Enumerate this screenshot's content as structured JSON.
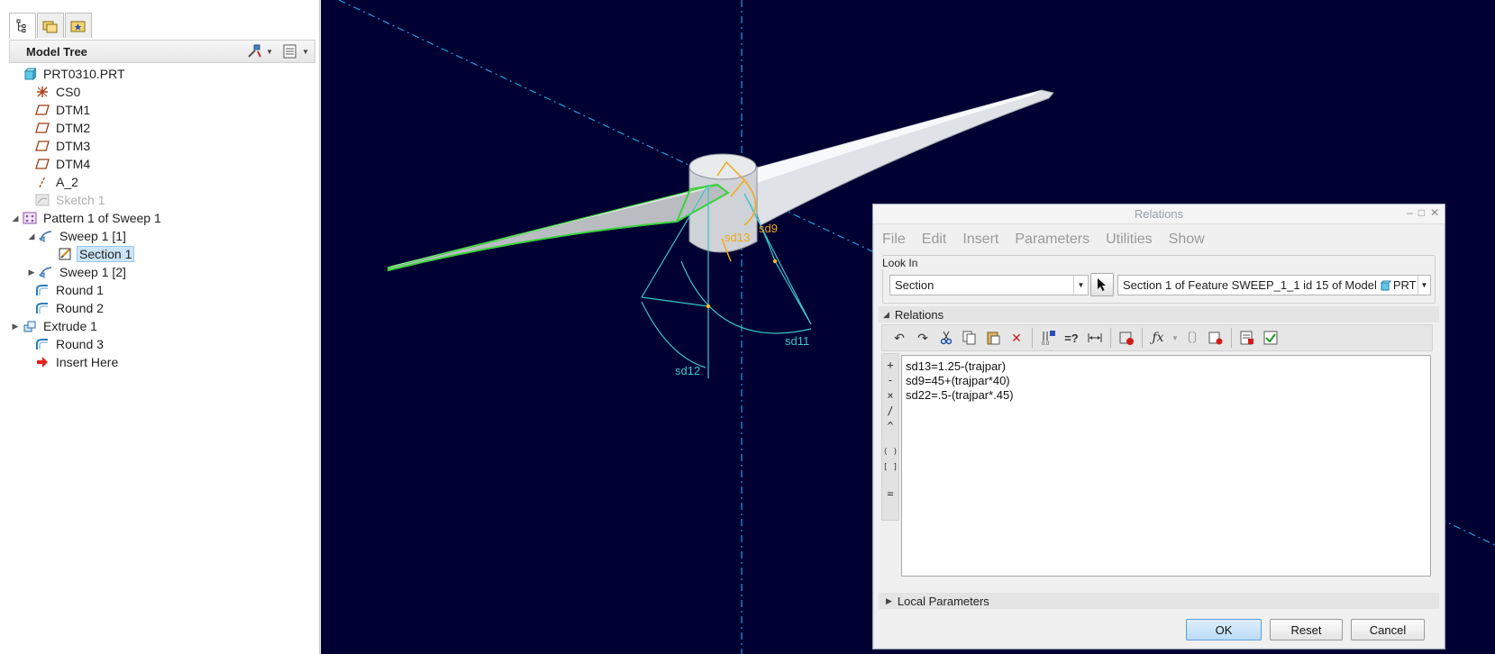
{
  "model_tree": {
    "title": "Model Tree",
    "items": [
      {
        "label": "PRT0310.PRT",
        "icon": "part-icon"
      },
      {
        "label": "CS0",
        "icon": "coordinate-system-icon"
      },
      {
        "label": "DTM1",
        "icon": "datum-plane-icon"
      },
      {
        "label": "DTM2",
        "icon": "datum-plane-icon"
      },
      {
        "label": "DTM3",
        "icon": "datum-plane-icon"
      },
      {
        "label": "DTM4",
        "icon": "datum-plane-icon"
      },
      {
        "label": "A_2",
        "icon": "datum-axis-icon"
      },
      {
        "label": "Sketch 1",
        "icon": "sketch-icon"
      },
      {
        "label": "Pattern 1 of Sweep 1",
        "icon": "pattern-icon"
      },
      {
        "label": "Sweep 1 [1]",
        "icon": "sweep-icon"
      },
      {
        "label": "Section 1",
        "icon": "section-icon"
      },
      {
        "label": "Sweep 1 [2]",
        "icon": "sweep-icon"
      },
      {
        "label": "Round 1",
        "icon": "round-icon"
      },
      {
        "label": "Round 2",
        "icon": "round-icon"
      },
      {
        "label": "Extrude 1",
        "icon": "extrude-icon"
      },
      {
        "label": "Round 3",
        "icon": "round-icon"
      },
      {
        "label": "Insert Here",
        "icon": "insert-arrow-icon"
      }
    ]
  },
  "viewport": {
    "dimension_labels": {
      "sd13": "sd13",
      "sd9": "sd9",
      "sd11": "sd11",
      "sd12": "sd12"
    }
  },
  "dialog": {
    "title": "Relations",
    "menu": [
      "File",
      "Edit",
      "Insert",
      "Parameters",
      "Utilities",
      "Show"
    ],
    "look_in": {
      "label": "Look In",
      "selected": "Section",
      "field_value": "Section 1 of Feature SWEEP_1_1 id 15 of Model",
      "field_suffix": "PRT"
    },
    "relations_section": "Relations",
    "operators": [
      "+",
      "-",
      "×",
      "/",
      "^",
      "( )",
      "[ ]",
      "="
    ],
    "relations_text": [
      "sd13=1.25-(trajpar)",
      "sd9=45+(trajpar*40)",
      "sd22=.5-(trajpar*.45)"
    ],
    "local_parameters": "Local Parameters",
    "buttons": {
      "ok": "OK",
      "reset": "Reset",
      "cancel": "Cancel"
    }
  },
  "colors": {
    "viewport_bg": "#000033",
    "datum_line": "#1e9fd8",
    "sketch_cyan": "#3cc6c6",
    "dimension_orange": "#f0a818",
    "highlight_green": "#3bd23b",
    "selection_blue": "#cce4f7"
  }
}
